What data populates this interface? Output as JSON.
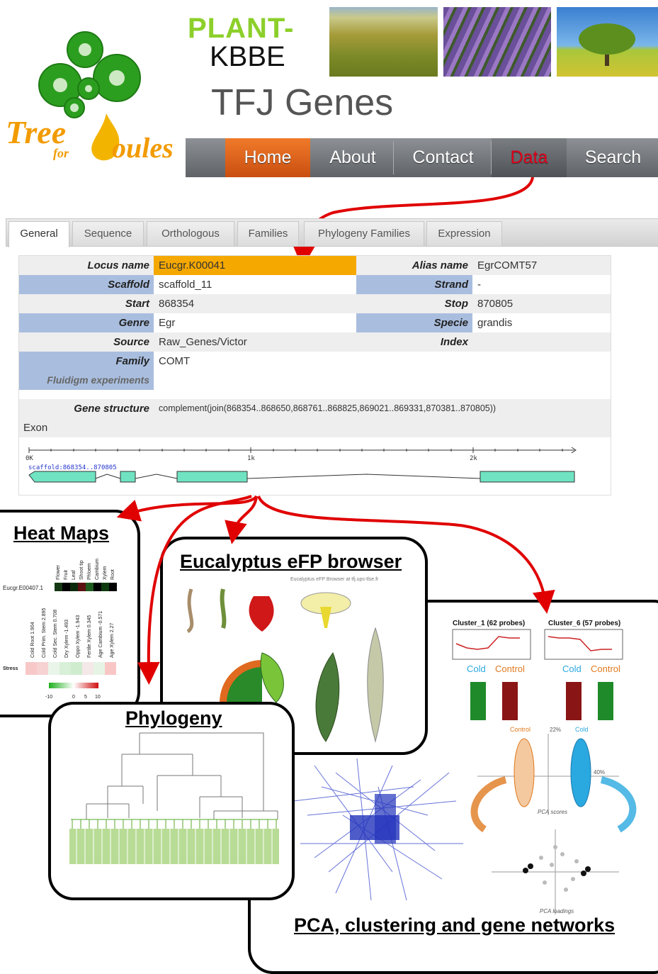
{
  "logo": {
    "word1": "Tree",
    "word2": "for",
    "word3": "oules"
  },
  "header": {
    "plant": "PLANT-",
    "kbbe": "KBBE",
    "title": "TFJ Genes"
  },
  "nav": {
    "items": [
      "Home",
      "About",
      "Contact",
      "Data",
      "Search"
    ],
    "active": "Home",
    "highlight": "Data"
  },
  "tabs": [
    "General",
    "Sequence",
    "Orthologous",
    "Families",
    "Phylogeny Families",
    "Expression"
  ],
  "gene": {
    "locus_label": "Locus name",
    "locus": "Eucgr.K00041",
    "alias_label": "Alias name",
    "alias": "EgrCOMT57",
    "scaffold_label": "Scaffold",
    "scaffold": "scaffold_11",
    "strand_label": "Strand",
    "strand": "-",
    "start_label": "Start",
    "start": "868354",
    "stop_label": "Stop",
    "stop": "870805",
    "genre_label": "Genre",
    "genre": "Egr",
    "specie_label": "Specie",
    "specie": "grandis",
    "source_label": "Source",
    "source": "Raw_Genes/Victor",
    "index_label": "Index",
    "family_label": "Family",
    "family": "COMT",
    "fluidigm_label": "Fluidigm experiments",
    "structure_label": "Gene structure",
    "structure": "complement(join(868354..868650,868761..868825,869021..869331,870381..870805))",
    "exon_label": "Exon",
    "axis_ticks": [
      "0K",
      "1k",
      "2k"
    ],
    "track_label": "scaffold:868354..870805"
  },
  "panels": {
    "heatmaps": {
      "title": "Heat Maps",
      "gene_id": "Eucgr.E00407.1",
      "tissues": [
        "Flower",
        "Fruit",
        "Leaf",
        "Shoot tip",
        "Phloem",
        "Cambium",
        "Xylem",
        "Root"
      ],
      "conditions": [
        "Cold Root 1.904",
        "Cold Prim. Stem 2.895",
        "Cold Sec. Stem 0.708",
        "Dry Xylem -1.493",
        "Oppo Xylem -1.943",
        "Fertile Xylem 0.345",
        "Age Cambium -0.571",
        "Age Xylem 2.27"
      ],
      "stress_label": "Stress",
      "scale": [
        "-10",
        "0",
        "5",
        "10"
      ]
    },
    "efp": {
      "title": "Eucalyptus eFP browser",
      "subtitle": "Eucalyptus eFP Browser at tfj.ups-tlse.fr"
    },
    "phylogeny": {
      "title": "Phylogeny"
    },
    "pca": {
      "title": "PCA, clustering and gene networks",
      "cluster1": "Cluster_1 (62 probes)",
      "cluster6": "Cluster_6 (57 probes)",
      "cold": "Cold",
      "control": "Control",
      "cold_color": "#2aa9e0",
      "control_color": "#e07a20",
      "pca_scores": "PCA scores",
      "pca_loadings": "PCA loadings",
      "pc1": "40%",
      "pc2": "22%"
    }
  },
  "colors": {
    "accent_green": "#8ccf2a",
    "nav_active": "#e0661a",
    "data_red": "#e0001b",
    "arrow_red": "#e00000",
    "blue_label": "#a9bedf",
    "locus_orange": "#f5a800"
  }
}
